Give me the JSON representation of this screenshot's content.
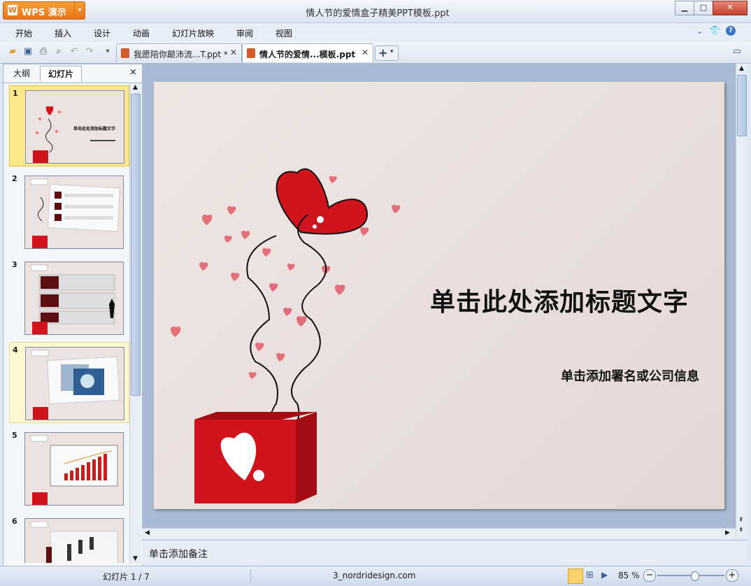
{
  "app": {
    "brand": "WPS 演示",
    "window_title": "情人节的爱情盒子精美PPT模板.ppt"
  },
  "menu": [
    "开始",
    "插入",
    "设计",
    "动画",
    "幻灯片放映",
    "审阅",
    "视图"
  ],
  "doc_tabs": [
    {
      "label": "我愿陪你颠沛流...T.ppt *",
      "active": false
    },
    {
      "label": "情人节的爱情...模板.ppt",
      "active": true
    }
  ],
  "panel": {
    "tab_outline": "大纲",
    "tab_slides": "幻灯片",
    "close": "×"
  },
  "thumbnails": [
    {
      "num": "1",
      "title": "单击此处添加标题文字"
    },
    {
      "num": "2",
      "title": ""
    },
    {
      "num": "3",
      "title": ""
    },
    {
      "num": "4",
      "title": ""
    },
    {
      "num": "5",
      "title": ""
    },
    {
      "num": "6",
      "title": ""
    }
  ],
  "slide": {
    "title": "单击此处添加标题文字",
    "subtitle": "单击添加署名或公司信息"
  },
  "notes": {
    "placeholder": "单击添加备注"
  },
  "status": {
    "slide_counter": "幻灯片 1 / 7",
    "source": "3_nordridesign.com",
    "zoom": "85 %",
    "zoom_level": 0.55
  },
  "colors": {
    "accent": "#e9731a",
    "box_red": "#d0141e",
    "heart": "#e04a5a"
  },
  "icons": [
    "open-folder-icon",
    "save-icon",
    "print-icon",
    "print-preview-icon",
    "undo-icon",
    "redo-icon",
    "dropdown-icon",
    "ppt-file-icon",
    "close-icon",
    "new-tab-icon",
    "minimize-icon",
    "maximize-icon",
    "help-icon",
    "skin-icon",
    "normal-view-icon",
    "sorter-view-icon",
    "play-icon",
    "zoom-out-icon",
    "zoom-in-icon"
  ]
}
